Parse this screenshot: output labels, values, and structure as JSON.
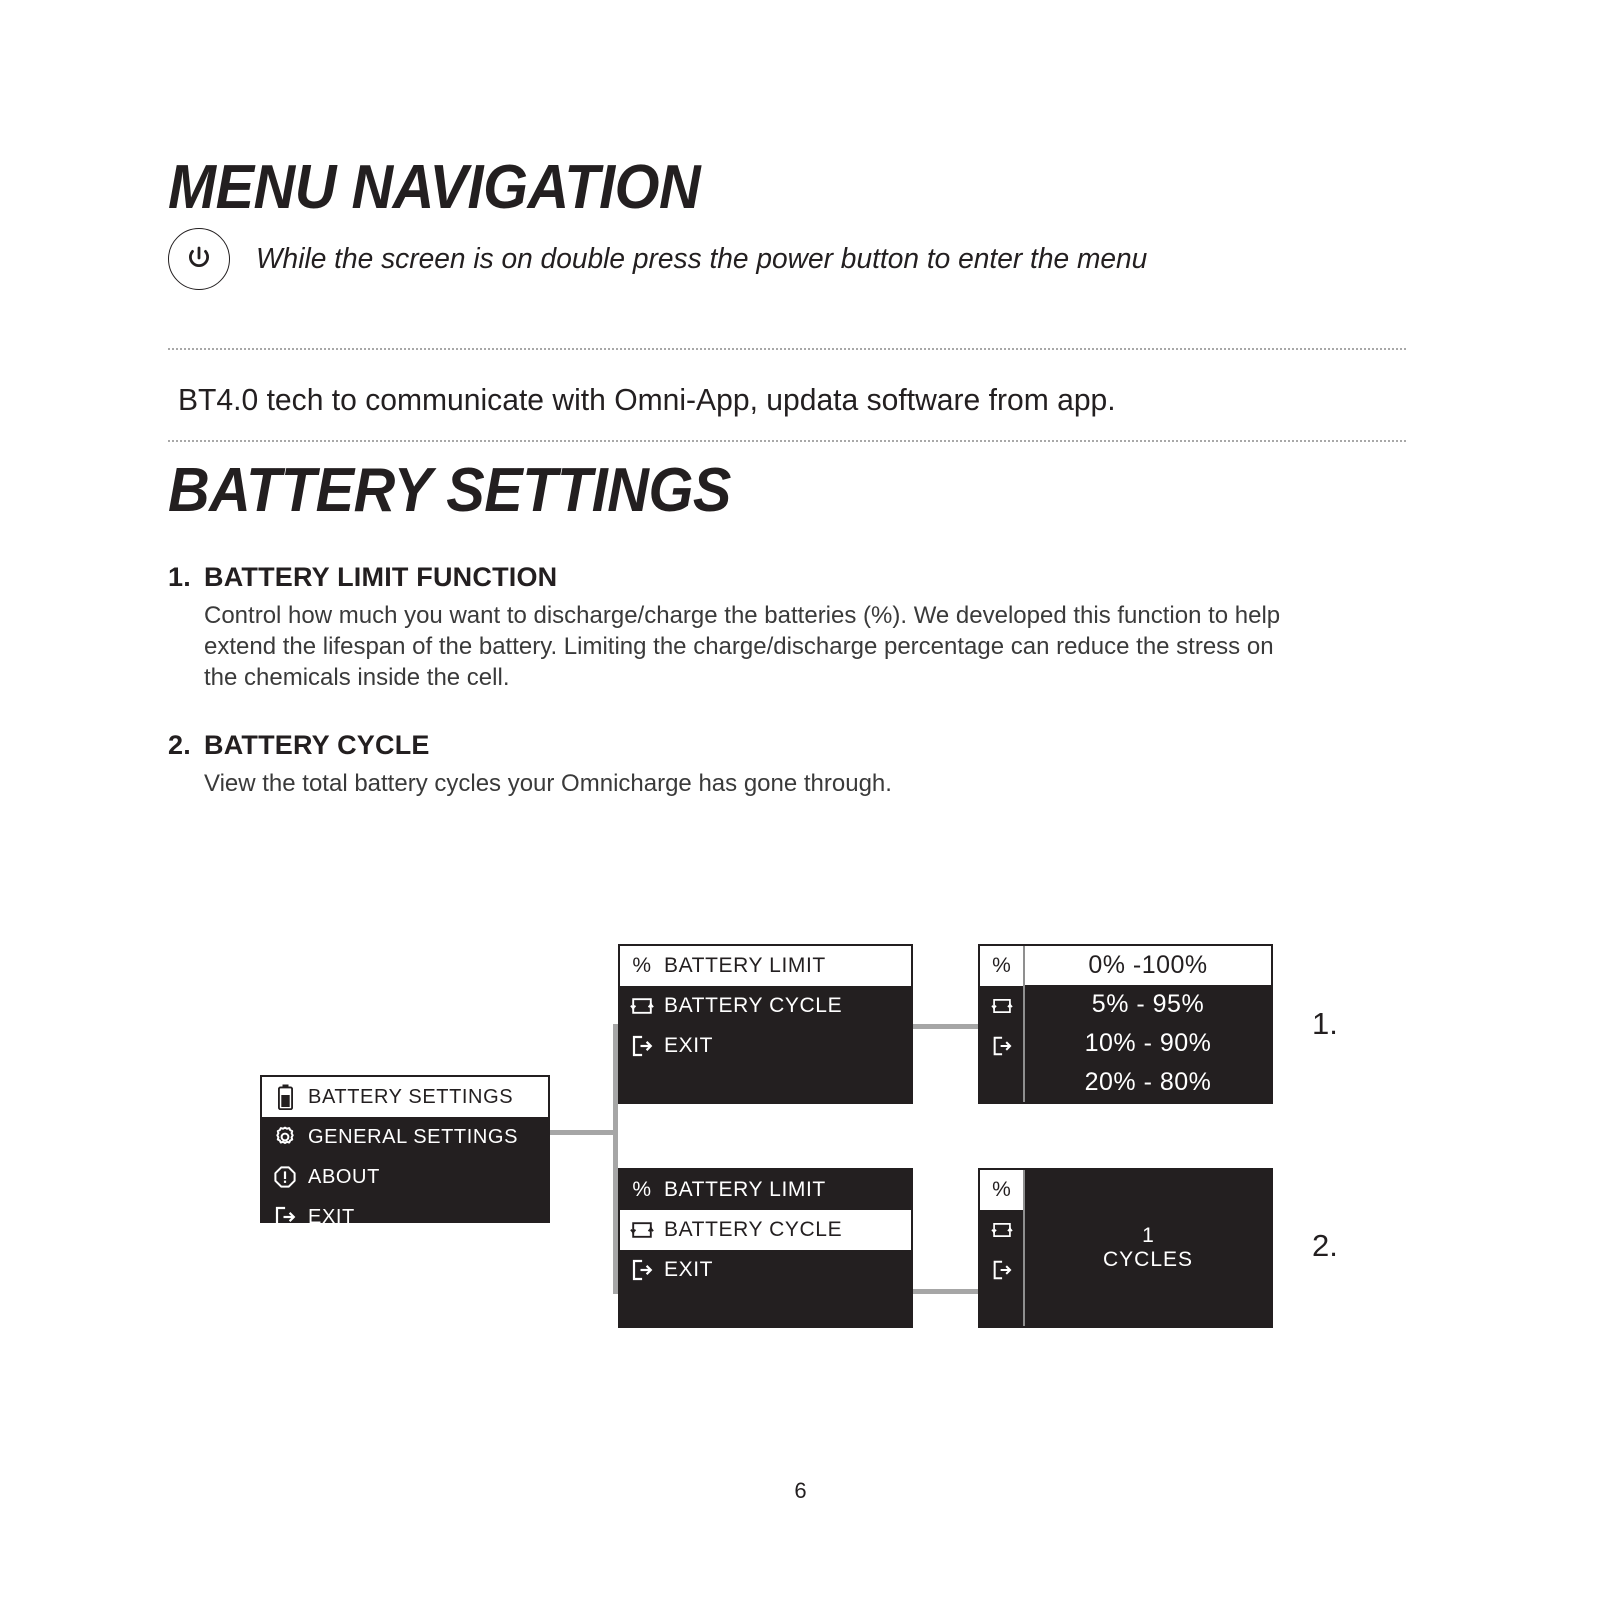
{
  "headings": {
    "menu_navigation": "MENU NAVIGATION",
    "battery_settings": "BATTERY SETTINGS"
  },
  "power_note": {
    "icon": "power-icon",
    "text": "While the screen is on double press the power button to enter the menu"
  },
  "bt_note": "BT4.0 tech to communicate with Omni-App, updata software from app.",
  "features": [
    {
      "number": "1.",
      "title": "BATTERY LIMIT FUNCTION",
      "body": "Control how much you want to discharge/charge the batteries (%). We developed this function to help extend the lifespan of the battery. Limiting the charge/discharge percentage can reduce the stress on the chemicals inside the cell."
    },
    {
      "number": "2.",
      "title": "BATTERY CYCLE",
      "body": "View the total battery cycles your Omnicharge has gone through."
    }
  ],
  "diagram": {
    "main_menu": {
      "items": [
        {
          "icon": "battery-icon",
          "label": "BATTERY SETTINGS",
          "selected": true
        },
        {
          "icon": "gear-icon",
          "label": "GENERAL SETTINGS",
          "selected": false
        },
        {
          "icon": "about-icon",
          "label": "ABOUT",
          "selected": false
        },
        {
          "icon": "exit-icon",
          "label": "EXIT",
          "selected": false
        }
      ]
    },
    "submenu_limit": {
      "items": [
        {
          "icon": "percent-icon",
          "label": "BATTERY LIMIT",
          "selected": true
        },
        {
          "icon": "cycle-icon",
          "label": "BATTERY CYCLE",
          "selected": false
        },
        {
          "icon": "exit-icon",
          "label": "EXIT",
          "selected": false
        }
      ]
    },
    "submenu_cycle": {
      "items": [
        {
          "icon": "percent-icon",
          "label": "BATTERY LIMIT",
          "selected": false
        },
        {
          "icon": "cycle-icon",
          "label": "BATTERY CYCLE",
          "selected": true
        },
        {
          "icon": "exit-icon",
          "label": "EXIT",
          "selected": false
        }
      ]
    },
    "panel_limits": {
      "rail": [
        {
          "icon": "percent-icon",
          "glyph": "%",
          "selected": true
        },
        {
          "icon": "cycle-icon",
          "glyph": "",
          "selected": false
        },
        {
          "icon": "exit-icon",
          "glyph": "",
          "selected": false
        }
      ],
      "options": [
        {
          "label": "0%  -100%",
          "selected": true
        },
        {
          "label": "5%  -  95%",
          "selected": false
        },
        {
          "label": "10%  -  90%",
          "selected": false
        },
        {
          "label": "20%  -  80%",
          "selected": false
        }
      ]
    },
    "panel_cycles": {
      "rail": [
        {
          "icon": "percent-icon",
          "glyph": "%",
          "selected": true
        },
        {
          "icon": "cycle-icon",
          "glyph": "",
          "selected": false
        },
        {
          "icon": "exit-icon",
          "glyph": "",
          "selected": false
        }
      ],
      "count": "1",
      "count_label": "CYCLES"
    },
    "callouts": [
      "1.",
      "2."
    ]
  },
  "page_number": "6",
  "colors": {
    "ink": "#231f20",
    "screen_bg": "#231f20",
    "screen_fg": "#ffffff",
    "connector": "#a6a6a6",
    "divider_dots": "#a8a8a8"
  }
}
